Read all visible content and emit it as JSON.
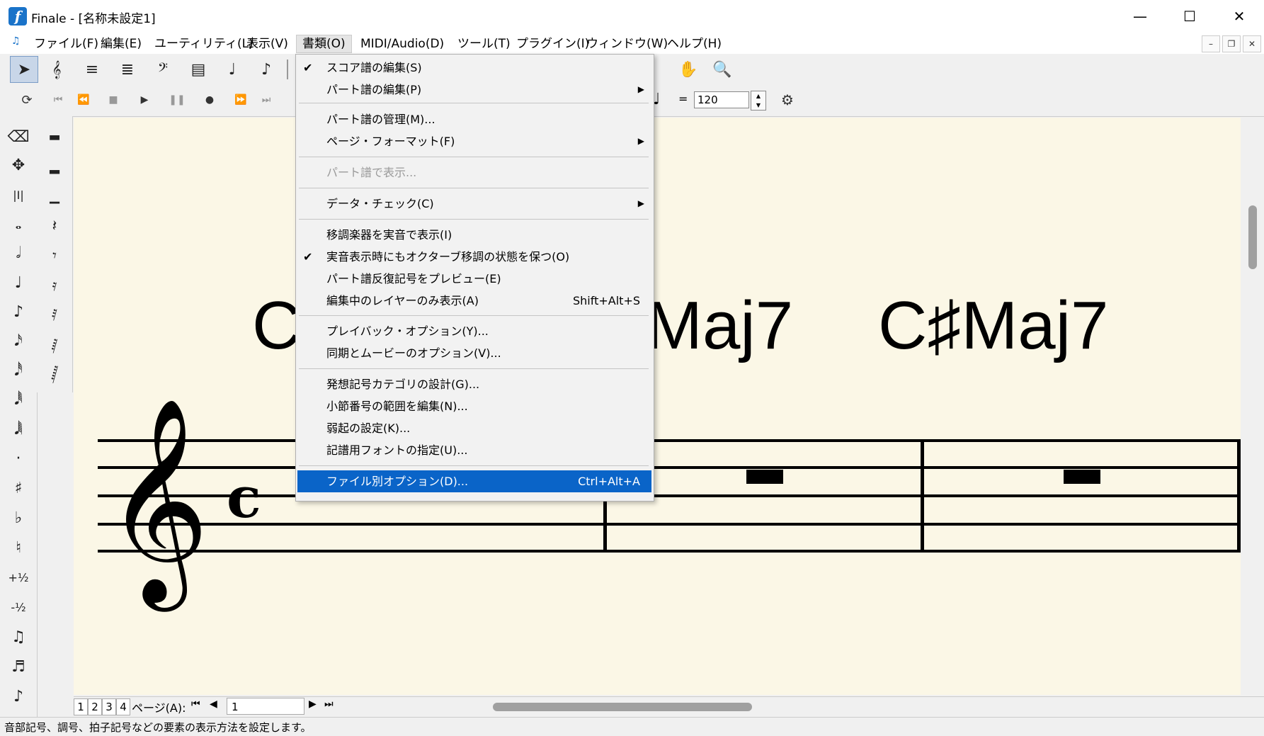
{
  "window": {
    "title": "Finale - [名称未設定1]",
    "logo_letter": "f",
    "controls": {
      "minimize": "—",
      "maximize": "☐",
      "close": "✕"
    }
  },
  "menubar": {
    "items": [
      {
        "label": "ファイル(F)"
      },
      {
        "label": "編集(E)"
      },
      {
        "label": "ユーティリティ(L)"
      },
      {
        "label": "表示(V)"
      },
      {
        "label": "書類(O)"
      },
      {
        "label": "MIDI/Audio(D)"
      },
      {
        "label": "ツール(T)"
      },
      {
        "label": "プラグイン(I)"
      },
      {
        "label": "ウィンドウ(W)"
      },
      {
        "label": "ヘルプ(H)"
      }
    ],
    "mdi": {
      "minimize": "–",
      "restore": "❐",
      "close": "✕"
    }
  },
  "playback": {
    "tempo_equals": "=",
    "tempo": "120"
  },
  "dropdown": {
    "items": [
      {
        "label": "スコア譜の編集(S)",
        "checked": true,
        "submenu": false,
        "shortcut": "",
        "disabled": false
      },
      {
        "label": "パート譜の編集(P)",
        "checked": false,
        "submenu": true,
        "shortcut": "",
        "disabled": false
      },
      {
        "label": "パート譜の管理(M)...",
        "checked": false,
        "submenu": false,
        "shortcut": "",
        "disabled": false
      },
      {
        "label": "ページ・フォーマット(F)",
        "checked": false,
        "submenu": true,
        "shortcut": "",
        "disabled": false
      },
      {
        "label": "パート譜で表示...",
        "checked": false,
        "submenu": false,
        "shortcut": "",
        "disabled": true
      },
      {
        "label": "データ・チェック(C)",
        "checked": false,
        "submenu": true,
        "shortcut": "",
        "disabled": false
      },
      {
        "label": "移調楽器を実音で表示(I)",
        "checked": false,
        "submenu": false,
        "shortcut": "",
        "disabled": false
      },
      {
        "label": "実音表示時にもオクターブ移調の状態を保つ(O)",
        "checked": true,
        "submenu": false,
        "shortcut": "",
        "disabled": false
      },
      {
        "label": "パート譜反復記号をプレビュー(E)",
        "checked": false,
        "submenu": false,
        "shortcut": "",
        "disabled": false
      },
      {
        "label": "編集中のレイヤーのみ表示(A)",
        "checked": false,
        "submenu": false,
        "shortcut": "Shift+Alt+S",
        "disabled": false
      },
      {
        "label": "プレイバック・オプション(Y)...",
        "checked": false,
        "submenu": false,
        "shortcut": "",
        "disabled": false
      },
      {
        "label": "同期とムービーのオプション(V)...",
        "checked": false,
        "submenu": false,
        "shortcut": "",
        "disabled": false
      },
      {
        "label": "発想記号カテゴリの設計(G)...",
        "checked": false,
        "submenu": false,
        "shortcut": "",
        "disabled": false
      },
      {
        "label": "小節番号の範囲を編集(N)...",
        "checked": false,
        "submenu": false,
        "shortcut": "",
        "disabled": false
      },
      {
        "label": "弱起の設定(K)...",
        "checked": false,
        "submenu": false,
        "shortcut": "",
        "disabled": false
      },
      {
        "label": "記譜用フォントの指定(U)...",
        "checked": false,
        "submenu": false,
        "shortcut": "",
        "disabled": false
      },
      {
        "label": "ファイル別オプション(D)...",
        "checked": false,
        "submenu": false,
        "shortcut": "Ctrl+Alt+A",
        "disabled": false,
        "highlighted": true
      }
    ]
  },
  "score": {
    "chords": [
      "C",
      "Maj7",
      "C♯Maj7"
    ],
    "clef": "𝄞",
    "time_signature": "𝄴"
  },
  "pages": {
    "tabs": [
      "1",
      "2",
      "3",
      "4"
    ],
    "label": "ページ(A):",
    "current": "1"
  },
  "status": {
    "text": "音部記号、調号、拍子記号などの要素の表示方法を設定します。"
  },
  "colors": {
    "highlight": "#0a64c8",
    "score_paper": "#fbf7e6",
    "logo": "#1a73c9"
  }
}
